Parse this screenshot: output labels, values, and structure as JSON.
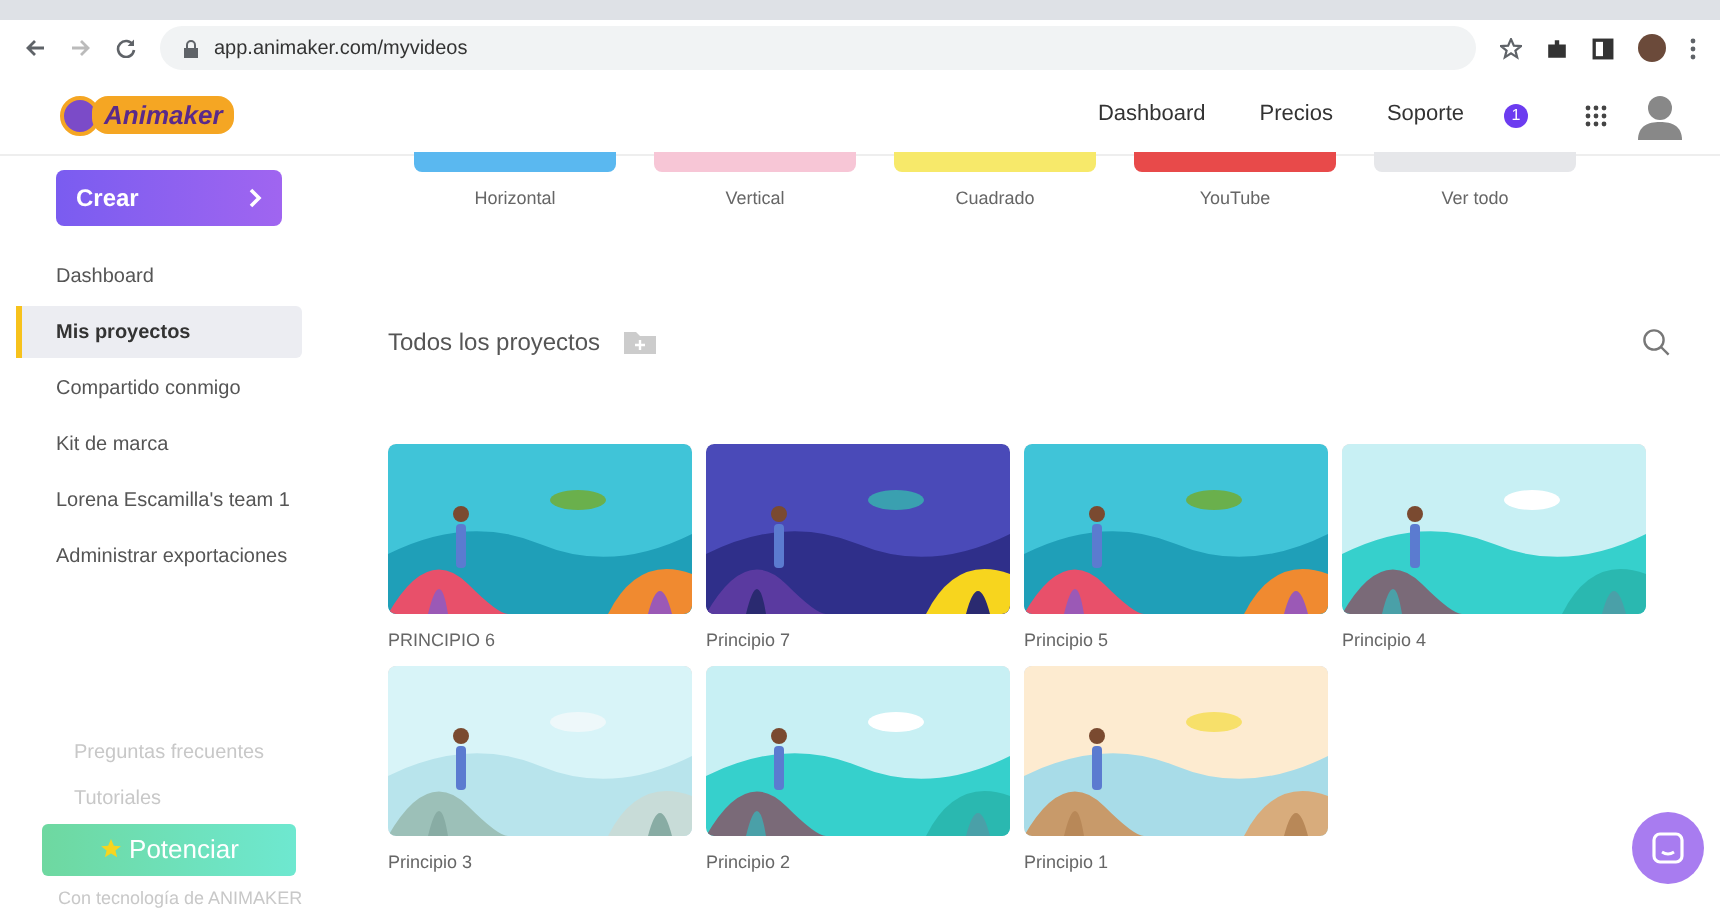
{
  "browser": {
    "url": "app.animaker.com/myvideos"
  },
  "header": {
    "logo": "Animaker",
    "nav": [
      "Dashboard",
      "Precios",
      "Soporte"
    ],
    "badge": "1"
  },
  "sidebar": {
    "create_button": "Crear",
    "items": [
      {
        "label": "Dashboard",
        "selected": false
      },
      {
        "label": "Mis proyectos",
        "selected": true
      },
      {
        "label": "Compartido conmigo",
        "selected": false
      },
      {
        "label": "Kit de marca",
        "selected": false
      },
      {
        "label": "Lorena Escamilla's team 1",
        "selected": false
      },
      {
        "label": "Administrar exportaciones",
        "selected": false
      }
    ],
    "footer_links": [
      "Preguntas frecuentes",
      "Tutoriales"
    ],
    "upgrade_button": "Potenciar",
    "powered_by": "Con tecnología de ANIMAKER"
  },
  "formats": [
    {
      "label": "Horizontal",
      "color": "#5ab8f0"
    },
    {
      "label": "Vertical",
      "color": "#f7c6d6"
    },
    {
      "label": "Cuadrado",
      "color": "#f7e96a"
    },
    {
      "label": "YouTube",
      "color": "#e84a4a"
    },
    {
      "label": "Ver todo",
      "color": "#e6e7ea"
    }
  ],
  "section_title": "Todos los proyectos",
  "projects": [
    {
      "title": "PRINCIPIO 6",
      "kind": "reef"
    },
    {
      "title": "Principio 7",
      "kind": "deep"
    },
    {
      "title": "Principio 5",
      "kind": "reef"
    },
    {
      "title": "Principio 4",
      "kind": "lagoon"
    },
    {
      "title": "Principio 3",
      "kind": "sky"
    },
    {
      "title": "Principio 2",
      "kind": "lagoon"
    },
    {
      "title": "Principio 1",
      "kind": "beach"
    }
  ]
}
